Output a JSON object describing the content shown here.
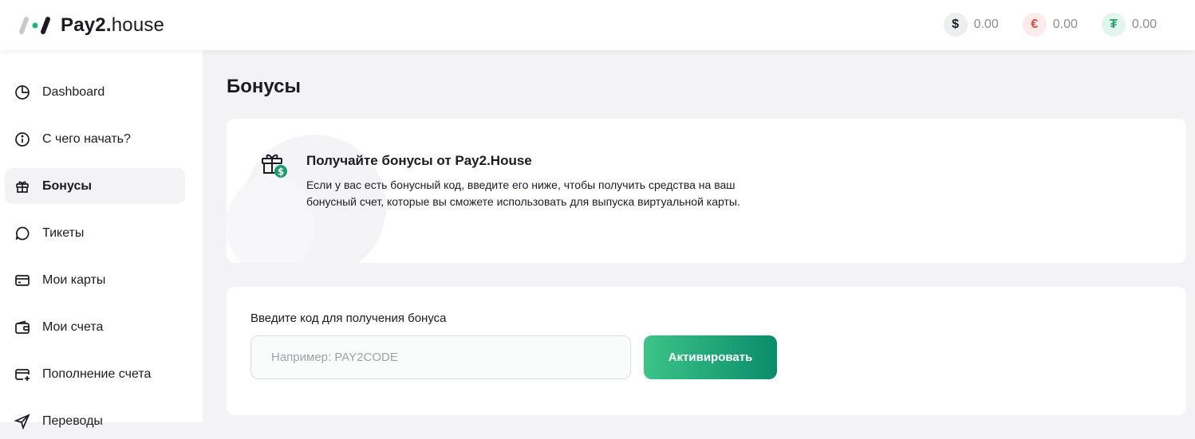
{
  "header": {
    "logo": {
      "bold": "Pay2.",
      "light": "house"
    },
    "balances": [
      {
        "currency_icon": "$",
        "icon": "dollar-icon",
        "value": "0.00",
        "color": "#1b1b24"
      },
      {
        "currency_icon": "€",
        "icon": "euro-icon",
        "value": "0.00",
        "color": "#d84a3f"
      },
      {
        "currency_icon": "₮",
        "icon": "tether-icon",
        "value": "0.00",
        "color": "#26a17b"
      }
    ]
  },
  "sidebar": {
    "items": [
      {
        "label": "Dashboard",
        "icon": "pie-chart-icon",
        "active": false
      },
      {
        "label": "С чего начать?",
        "icon": "info-icon",
        "active": false
      },
      {
        "label": "Бонусы",
        "icon": "gift-icon",
        "active": true
      },
      {
        "label": "Тикеты",
        "icon": "chat-bubble-icon",
        "active": false
      },
      {
        "label": "Мои карты",
        "icon": "card-icon",
        "active": false
      },
      {
        "label": "Мои счета",
        "icon": "wallet-icon",
        "active": false
      },
      {
        "label": "Пополнение счета",
        "icon": "card-plus-icon",
        "active": false
      },
      {
        "label": "Переводы",
        "icon": "send-icon",
        "active": false
      }
    ]
  },
  "main": {
    "title": "Бонусы",
    "info": {
      "title": "Получайте бонусы от Pay2.House",
      "text": "Если у вас есть бонусный код, введите его ниже, чтобы получить средства на ваш бонусный счет, которые вы сможете использовать для выпуска виртуальной карты."
    },
    "form": {
      "label": "Введите код для получения бонуса",
      "placeholder": "Например: PAY2CODE",
      "value": "",
      "button": "Активировать"
    }
  },
  "colors": {
    "accent_start": "#3cc487",
    "accent_end": "#0a8c6c"
  }
}
